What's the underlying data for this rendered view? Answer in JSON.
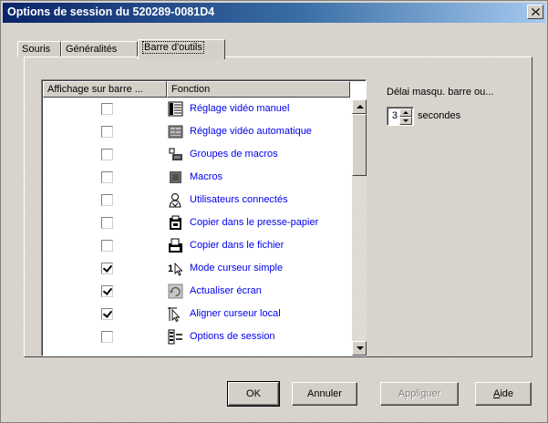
{
  "window": {
    "title": "Options de session du 520289-0081D4"
  },
  "tabs": [
    {
      "label": "Souris",
      "active": false
    },
    {
      "label": "Généralités",
      "active": false
    },
    {
      "label": "Barre d'outils",
      "active": true
    }
  ],
  "list": {
    "columns": [
      "Affichage sur barre ...",
      "Fonction"
    ],
    "rows": [
      {
        "checked": false,
        "icon": "manual-video-adjust-icon",
        "label": "Réglage vidéo manuel"
      },
      {
        "checked": false,
        "icon": "auto-video-adjust-icon",
        "label": "Réglage vidéo automatique"
      },
      {
        "checked": false,
        "icon": "macro-groups-icon",
        "label": "Groupes de macros"
      },
      {
        "checked": false,
        "icon": "macros-icon",
        "label": "Macros"
      },
      {
        "checked": false,
        "icon": "connected-users-icon",
        "label": "Utilisateurs connectés"
      },
      {
        "checked": false,
        "icon": "copy-clipboard-icon",
        "label": "Copier dans le presse-papier"
      },
      {
        "checked": false,
        "icon": "copy-file-icon",
        "label": "Copier dans le fichier"
      },
      {
        "checked": true,
        "icon": "single-cursor-icon",
        "label": "Mode curseur simple"
      },
      {
        "checked": true,
        "icon": "refresh-screen-icon",
        "label": "Actualiser écran"
      },
      {
        "checked": true,
        "icon": "align-cursor-icon",
        "label": "Aligner curseur local"
      },
      {
        "checked": false,
        "icon": "session-options-icon",
        "label": "Options de session"
      }
    ]
  },
  "delay": {
    "label": "Délai masqu. barre ou...",
    "value": "3",
    "unit": "secondes"
  },
  "buttons": {
    "ok": "OK",
    "cancel": "Annuler",
    "apply_pre": "Appli",
    "apply_accel": "q",
    "apply_post": "uer",
    "help_accel": "A",
    "help_post": "ide"
  }
}
